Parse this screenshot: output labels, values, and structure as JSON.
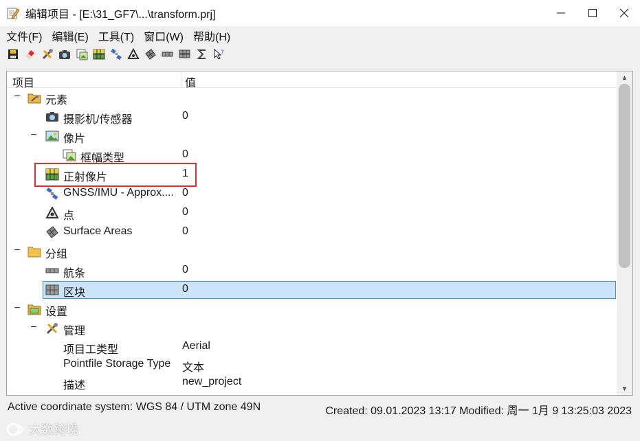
{
  "window": {
    "title": "编辑项目 - [E:\\31_GF7\\...\\transform.prj]",
    "controls": [
      "minimize-icon",
      "maximize-icon",
      "close-icon"
    ]
  },
  "menu": [
    {
      "label": "文件(F)"
    },
    {
      "label": "编辑(E)"
    },
    {
      "label": "工具(T)"
    },
    {
      "label": "窗口(W)"
    },
    {
      "label": "帮助(H)"
    }
  ],
  "toolbar": {
    "icons": [
      "save-icon",
      "eraser-icon",
      "tools-icon",
      "camera-icon",
      "frame-image-icon",
      "ortho-image-icon",
      "satellite-icon",
      "points-icon",
      "surface-icon",
      "strips-icon",
      "blocks-icon",
      "sigma-icon",
      "help-pointer-icon"
    ]
  },
  "tree": {
    "column_item": "项目",
    "column_value": "值",
    "rows": [
      {
        "label": "元素",
        "value": "",
        "toggle": "−",
        "icon": "tools-folder-icon"
      },
      {
        "label": "摄影机/传感器",
        "value": "0",
        "toggle": "",
        "icon": "camera-icon"
      },
      {
        "label": "像片",
        "value": "",
        "toggle": "−",
        "icon": "image-icon"
      },
      {
        "label": "框幅类型",
        "value": "0",
        "toggle": "",
        "icon": "frame-image-icon"
      },
      {
        "label": "正射像片",
        "value": "1",
        "toggle": "",
        "icon": "ortho-image-icon"
      },
      {
        "label": "GNSS/IMU - Approx....",
        "value": "0",
        "toggle": "",
        "icon": "satellite-icon"
      },
      {
        "label": "点",
        "value": "0",
        "toggle": "",
        "icon": "points-icon"
      },
      {
        "label": "Surface Areas",
        "value": "0",
        "toggle": "",
        "icon": "surface-icon"
      },
      {
        "label": "分组",
        "value": "",
        "toggle": "−",
        "icon": "folder-icon"
      },
      {
        "label": "航条",
        "value": "0",
        "toggle": "",
        "icon": "strips-icon"
      },
      {
        "label": "区块",
        "value": "0",
        "toggle": "",
        "icon": "blocks-icon"
      },
      {
        "label": "设置",
        "value": "",
        "toggle": "−",
        "icon": "settings-folder-icon"
      },
      {
        "label": "管理",
        "value": "",
        "toggle": "−",
        "icon": "tools-icon"
      },
      {
        "label": "项目工类型",
        "value": "Aerial",
        "toggle": "",
        "icon": ""
      },
      {
        "label": "Pointfile Storage Type",
        "value": "文本",
        "toggle": "",
        "icon": ""
      },
      {
        "label": "描述",
        "value": "new_project",
        "toggle": "",
        "icon": ""
      }
    ]
  },
  "status": {
    "coordinate_system": "Active coordinate system: WGS 84 / UTM zone 49N",
    "dates": "Created: 09.01.2023 13:17  Modified: 周一 1月 9 13:25:03 2023"
  },
  "watermark": "大数跨境",
  "colors": {
    "selection": "#cce4f7",
    "highlight": "#e03030"
  }
}
